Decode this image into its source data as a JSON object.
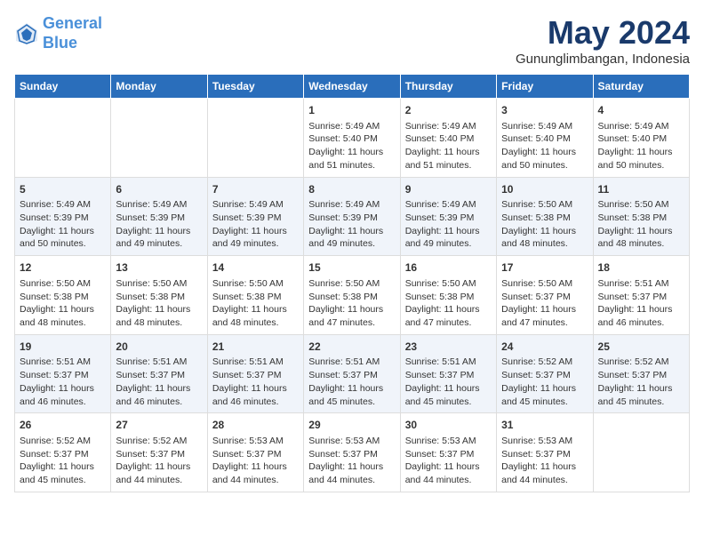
{
  "logo": {
    "line1": "General",
    "line2": "Blue"
  },
  "title": "May 2024",
  "subtitle": "Gununglimbangan, Indonesia",
  "days": [
    "Sunday",
    "Monday",
    "Tuesday",
    "Wednesday",
    "Thursday",
    "Friday",
    "Saturday"
  ],
  "weeks": [
    [
      {
        "day": "",
        "info": ""
      },
      {
        "day": "",
        "info": ""
      },
      {
        "day": "",
        "info": ""
      },
      {
        "day": "1",
        "info": "Sunrise: 5:49 AM\nSunset: 5:40 PM\nDaylight: 11 hours and 51 minutes."
      },
      {
        "day": "2",
        "info": "Sunrise: 5:49 AM\nSunset: 5:40 PM\nDaylight: 11 hours and 51 minutes."
      },
      {
        "day": "3",
        "info": "Sunrise: 5:49 AM\nSunset: 5:40 PM\nDaylight: 11 hours and 50 minutes."
      },
      {
        "day": "4",
        "info": "Sunrise: 5:49 AM\nSunset: 5:40 PM\nDaylight: 11 hours and 50 minutes."
      }
    ],
    [
      {
        "day": "5",
        "info": "Sunrise: 5:49 AM\nSunset: 5:39 PM\nDaylight: 11 hours and 50 minutes."
      },
      {
        "day": "6",
        "info": "Sunrise: 5:49 AM\nSunset: 5:39 PM\nDaylight: 11 hours and 49 minutes."
      },
      {
        "day": "7",
        "info": "Sunrise: 5:49 AM\nSunset: 5:39 PM\nDaylight: 11 hours and 49 minutes."
      },
      {
        "day": "8",
        "info": "Sunrise: 5:49 AM\nSunset: 5:39 PM\nDaylight: 11 hours and 49 minutes."
      },
      {
        "day": "9",
        "info": "Sunrise: 5:49 AM\nSunset: 5:39 PM\nDaylight: 11 hours and 49 minutes."
      },
      {
        "day": "10",
        "info": "Sunrise: 5:50 AM\nSunset: 5:38 PM\nDaylight: 11 hours and 48 minutes."
      },
      {
        "day": "11",
        "info": "Sunrise: 5:50 AM\nSunset: 5:38 PM\nDaylight: 11 hours and 48 minutes."
      }
    ],
    [
      {
        "day": "12",
        "info": "Sunrise: 5:50 AM\nSunset: 5:38 PM\nDaylight: 11 hours and 48 minutes."
      },
      {
        "day": "13",
        "info": "Sunrise: 5:50 AM\nSunset: 5:38 PM\nDaylight: 11 hours and 48 minutes."
      },
      {
        "day": "14",
        "info": "Sunrise: 5:50 AM\nSunset: 5:38 PM\nDaylight: 11 hours and 48 minutes."
      },
      {
        "day": "15",
        "info": "Sunrise: 5:50 AM\nSunset: 5:38 PM\nDaylight: 11 hours and 47 minutes."
      },
      {
        "day": "16",
        "info": "Sunrise: 5:50 AM\nSunset: 5:38 PM\nDaylight: 11 hours and 47 minutes."
      },
      {
        "day": "17",
        "info": "Sunrise: 5:50 AM\nSunset: 5:37 PM\nDaylight: 11 hours and 47 minutes."
      },
      {
        "day": "18",
        "info": "Sunrise: 5:51 AM\nSunset: 5:37 PM\nDaylight: 11 hours and 46 minutes."
      }
    ],
    [
      {
        "day": "19",
        "info": "Sunrise: 5:51 AM\nSunset: 5:37 PM\nDaylight: 11 hours and 46 minutes."
      },
      {
        "day": "20",
        "info": "Sunrise: 5:51 AM\nSunset: 5:37 PM\nDaylight: 11 hours and 46 minutes."
      },
      {
        "day": "21",
        "info": "Sunrise: 5:51 AM\nSunset: 5:37 PM\nDaylight: 11 hours and 46 minutes."
      },
      {
        "day": "22",
        "info": "Sunrise: 5:51 AM\nSunset: 5:37 PM\nDaylight: 11 hours and 45 minutes."
      },
      {
        "day": "23",
        "info": "Sunrise: 5:51 AM\nSunset: 5:37 PM\nDaylight: 11 hours and 45 minutes."
      },
      {
        "day": "24",
        "info": "Sunrise: 5:52 AM\nSunset: 5:37 PM\nDaylight: 11 hours and 45 minutes."
      },
      {
        "day": "25",
        "info": "Sunrise: 5:52 AM\nSunset: 5:37 PM\nDaylight: 11 hours and 45 minutes."
      }
    ],
    [
      {
        "day": "26",
        "info": "Sunrise: 5:52 AM\nSunset: 5:37 PM\nDaylight: 11 hours and 45 minutes."
      },
      {
        "day": "27",
        "info": "Sunrise: 5:52 AM\nSunset: 5:37 PM\nDaylight: 11 hours and 44 minutes."
      },
      {
        "day": "28",
        "info": "Sunrise: 5:53 AM\nSunset: 5:37 PM\nDaylight: 11 hours and 44 minutes."
      },
      {
        "day": "29",
        "info": "Sunrise: 5:53 AM\nSunset: 5:37 PM\nDaylight: 11 hours and 44 minutes."
      },
      {
        "day": "30",
        "info": "Sunrise: 5:53 AM\nSunset: 5:37 PM\nDaylight: 11 hours and 44 minutes."
      },
      {
        "day": "31",
        "info": "Sunrise: 5:53 AM\nSunset: 5:37 PM\nDaylight: 11 hours and 44 minutes."
      },
      {
        "day": "",
        "info": ""
      }
    ]
  ]
}
